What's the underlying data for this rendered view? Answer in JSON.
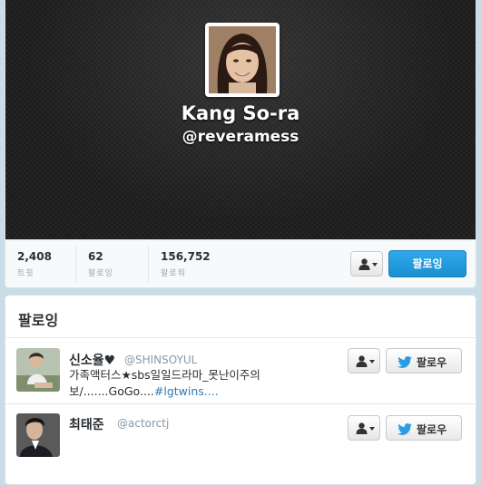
{
  "profile": {
    "name": "Kang So-ra",
    "handle": "@reveramess",
    "avatar_icon": "profile-photo"
  },
  "stats": [
    {
      "value": "2,408",
      "label": "트윗"
    },
    {
      "value": "62",
      "label": "팔로잉"
    },
    {
      "value": "156,752",
      "label": "팔로워"
    }
  ],
  "actions": {
    "following_label": "팔로잉",
    "user_menu_icon": "person-icon"
  },
  "following_panel": {
    "title": "팔로잉",
    "follow_label": "팔로우",
    "users": [
      {
        "name": "신소율♥",
        "handle": "@SHINSOYUL",
        "bio_text": "가족액터스★sbs일일드라마_못난이주의보/.......GoGo....",
        "bio_link": "#lgtwins...."
      },
      {
        "name": "최태준",
        "handle": "@actorctj"
      }
    ]
  },
  "colors": {
    "accent": "#1a8fd1",
    "link": "#2b7bb9",
    "header_bg": "#1c1c1c"
  }
}
